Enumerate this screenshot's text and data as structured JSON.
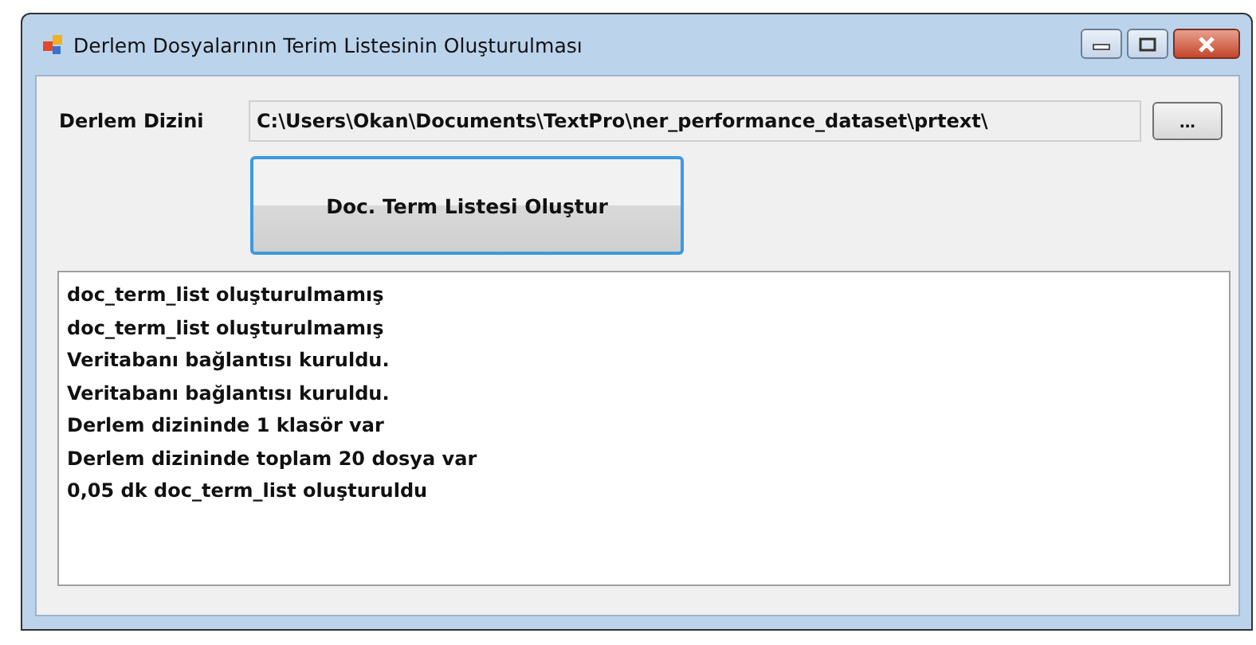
{
  "window": {
    "title": "Derlem Dosyalarının Terim Listesinin Oluşturulması"
  },
  "path_label": "Derlem Dizini",
  "path_field": {
    "value": "C:\\Users\\Okan\\Documents\\TextPro\\ner_performance_dataset\\prtext\\"
  },
  "browse_button": "...",
  "create_button": {
    "label": "Doc. Term Listesi Oluştur",
    "focused": true
  },
  "log_lines": [
    "doc_term_list oluşturulmamış",
    "doc_term_list oluşturulmamış",
    "Veritabanı bağlantısı kuruldu.",
    "Veritabanı bağlantısı kuruldu.",
    "Derlem dizininde 1 klasör var",
    "Derlem dizininde toplam 20 dosya var",
    "0,05 dk doc_term_list oluşturuldu"
  ]
}
